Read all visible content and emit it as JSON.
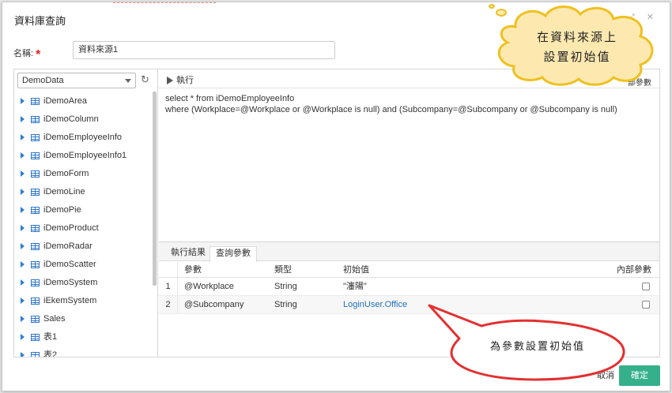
{
  "dialog": {
    "title": "資料庫查詢",
    "header_icons": "⤢ ✕"
  },
  "name_field": {
    "label": "名稱:",
    "required_mark": "*",
    "value": "資料來源1"
  },
  "datasource": {
    "selected": "DemoData",
    "tables": [
      "iDemoArea",
      "iDemoColumn",
      "iDemoEmployeeInfo",
      "iDemoEmployeeInfo1",
      "iDemoForm",
      "iDemoLine",
      "iDemoPie",
      "iDemoProduct",
      "iDemoRadar",
      "iDemoScatter",
      "iDemoSystem",
      "iEkemSystem",
      "Sales",
      "表1",
      "表2"
    ]
  },
  "editor": {
    "run_label": "執行",
    "hidden_param_label": "部參數",
    "sql_line1": "select * from iDemoEmployeeInfo",
    "sql_line2": "where (Workplace=@Workplace or @Workplace is null) and (Subcompany=@Subcompany or @Subcompany is null)"
  },
  "tabs": {
    "result": "執行結果",
    "params": "查詢參數"
  },
  "grid": {
    "headers": {
      "param": "參數",
      "type": "類型",
      "init": "初始值",
      "internal": "內部參數"
    },
    "rows": [
      {
        "index": "1",
        "param": "@Workplace",
        "type": "String",
        "init": "\"瀋陽\""
      },
      {
        "index": "2",
        "param": "@Subcompany",
        "type": "String",
        "init": "LoginUser.Office"
      }
    ]
  },
  "buttons": {
    "cancel": "取消",
    "ok": "確定"
  },
  "callouts": {
    "cloud_line1": "在資料來源上",
    "cloud_line2": "設置初始值",
    "oval": "為參數設置初始值"
  },
  "colors": {
    "accent": "#35b08a",
    "link": "#1f6fbf",
    "callout_fill": "#fde9b0",
    "callout_stroke": "#f0c020",
    "oval_stroke": "#e33030"
  }
}
